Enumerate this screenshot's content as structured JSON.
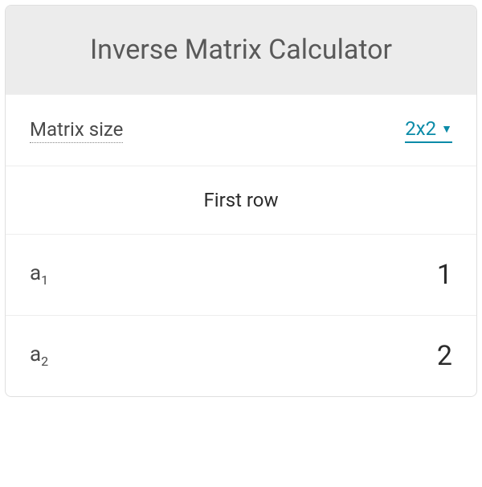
{
  "header": {
    "title": "Inverse Matrix Calculator"
  },
  "matrixSize": {
    "label": "Matrix size",
    "value": "2x2"
  },
  "firstRow": {
    "title": "First row",
    "items": [
      {
        "label": "a",
        "sub": "1",
        "value": "1"
      },
      {
        "label": "a",
        "sub": "2",
        "value": "2"
      }
    ]
  }
}
